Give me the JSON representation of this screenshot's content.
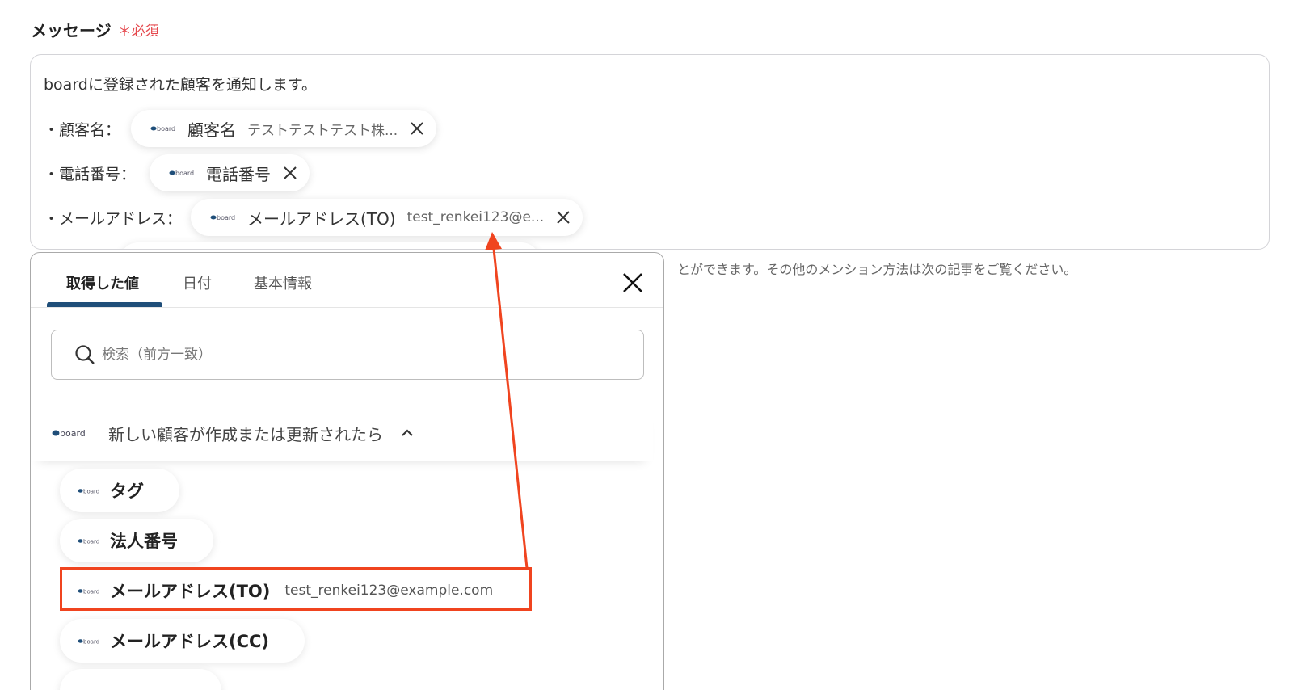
{
  "field": {
    "label": "メッセージ",
    "required_mark": "＊",
    "required_text": "必須"
  },
  "editor": {
    "intro": "boardに登録された顧客を通知します。",
    "rows": [
      {
        "label": "・顧客名：",
        "pill_name": "顧客名",
        "pill_value": "テストテストテスト株..."
      },
      {
        "label": "・電話番号：",
        "pill_name": "電話番号",
        "pill_value": ""
      },
      {
        "label": "・メールアドレス：",
        "pill_name": "メールアドレス(TO)",
        "pill_value": "test_renkei123@e..."
      }
    ]
  },
  "helper_text": "とができます。その他のメンション方法は次の記事をご覧ください。",
  "panel": {
    "tabs": [
      "取得した値",
      "日付",
      "基本情報"
    ],
    "active_tab": "取得した値",
    "search_placeholder": "検索（前方一致）",
    "section_title": "新しい顧客が作成または更新されたら",
    "items": [
      {
        "name": "タグ",
        "value": ""
      },
      {
        "name": "法人番号",
        "value": ""
      },
      {
        "name": "メールアドレス(TO)",
        "value": "test_renkei123@example.com"
      },
      {
        "name": "メールアドレス(CC)",
        "value": ""
      }
    ]
  },
  "brand_logo_text": "board",
  "icons": {
    "pill_remove": "close-icon",
    "panel_close": "close-icon",
    "search": "search-icon",
    "section_toggle": "chevron-up-icon",
    "app_logo": "board-logo-icon"
  },
  "colors": {
    "required": "#e5484d",
    "tab_underline": "#1f4e79",
    "highlight": "#f0441f",
    "logo_dot": "#1f4e79"
  }
}
